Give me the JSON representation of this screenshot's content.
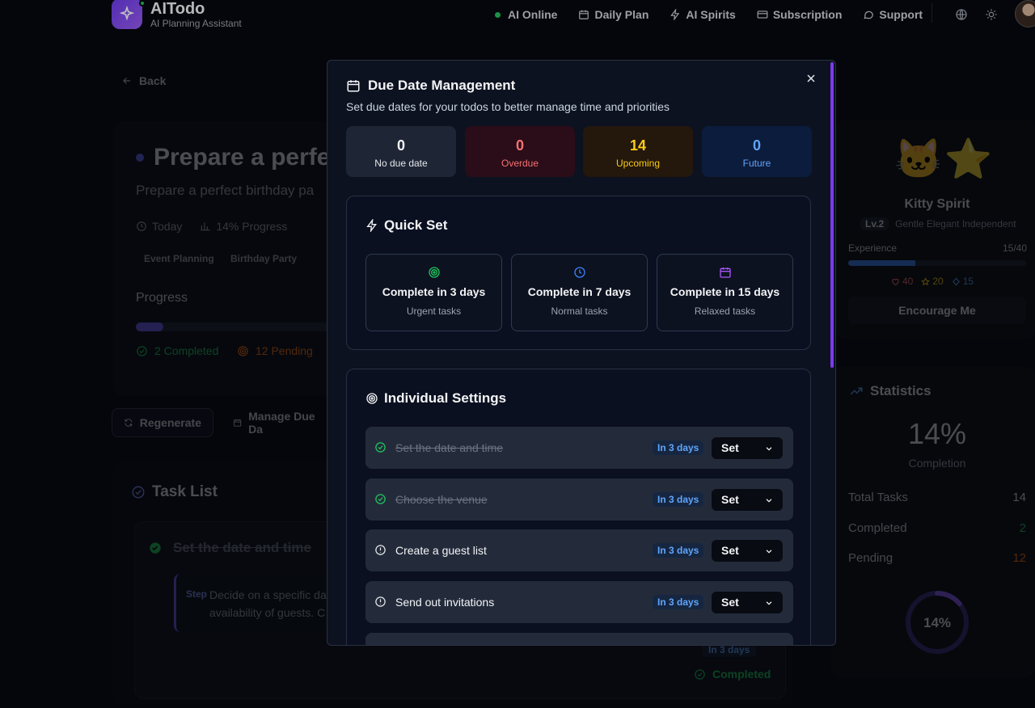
{
  "header": {
    "app_name": "AITodo",
    "app_subtitle": "AI Planning Assistant",
    "nav": [
      "AI Online",
      "Daily Plan",
      "AI Spirits",
      "Subscription",
      "Support"
    ]
  },
  "background": {
    "back_label": "Back",
    "todo_title": "Prepare a perfe",
    "todo_subtitle": "Prepare a perfect birthday pa",
    "meta_date": "Today",
    "meta_progress": "14% Progress",
    "tags": [
      "Event Planning",
      "Birthday Party"
    ],
    "progress_label": "Progress",
    "progress_fraction": 0.14,
    "completed_text": "2 Completed",
    "pending_text": "12 Pending",
    "regenerate_label": "Regenerate",
    "manage_due_label": "Manage Due Da",
    "task_list_title": "Task List",
    "task_item_title": "Set the date and time",
    "step_label": "Step",
    "step_text": "Decide on a specific da availability of guests. C",
    "task_badge": "In 3 days",
    "task_status": "Completed"
  },
  "spirit": {
    "emoji": "🐱⭐",
    "name": "Kitty Spirit",
    "level": "Lv.2",
    "traits": "Gentle Elegant Independent",
    "experience_label": "Experience",
    "experience_value": "15/40",
    "experience_fraction": 0.375,
    "hearts": "40",
    "stars": "20",
    "diamonds": "15",
    "encourage_label": "Encourage Me"
  },
  "statistics": {
    "title": "Statistics",
    "completion_pct": "14%",
    "completion_label": "Completion",
    "rows": [
      {
        "label": "Total Tasks",
        "value": "14",
        "color": "#e5e7eb"
      },
      {
        "label": "Completed",
        "value": "2",
        "color": "#22c55e"
      },
      {
        "label": "Pending",
        "value": "12",
        "color": "#f97316"
      }
    ],
    "ring_label": "14%",
    "ring_fraction": 0.14
  },
  "modal": {
    "title": "Due Date Management",
    "subtitle": "Set due dates for your todos to better manage time and priorities",
    "counts": [
      {
        "value": "0",
        "label": "No due date",
        "bg": "#1e2636",
        "num_color": "#f3f4f6",
        "lbl_color": "#e5e7eb"
      },
      {
        "value": "0",
        "label": "Overdue",
        "bg": "#2a0d18",
        "num_color": "#f87171",
        "lbl_color": "#f87171"
      },
      {
        "value": "14",
        "label": "Upcoming",
        "bg": "#24170c",
        "num_color": "#facc15",
        "lbl_color": "#facc15"
      },
      {
        "value": "0",
        "label": "Future",
        "bg": "#0c1c3c",
        "num_color": "#60a5fa",
        "lbl_color": "#60a5fa"
      }
    ],
    "quick_set_title": "Quick Set",
    "quick_options": [
      {
        "title": "Complete in 3 days",
        "sub": "Urgent tasks",
        "icon": "target-icon",
        "color": "#22c55e"
      },
      {
        "title": "Complete in 7 days",
        "sub": "Normal tasks",
        "icon": "clock-icon",
        "color": "#3b82f6"
      },
      {
        "title": "Complete in 15 days",
        "sub": "Relaxed tasks",
        "icon": "calendar-icon",
        "color": "#a855f7"
      }
    ],
    "individual_title": "Individual Settings",
    "todos": [
      {
        "name": "Set the date and time",
        "done": true,
        "badge": "In 3 days",
        "select": "Set"
      },
      {
        "name": "Choose the venue",
        "done": true,
        "badge": "In 3 days",
        "select": "Set"
      },
      {
        "name": "Create a guest list",
        "done": false,
        "badge": "In 3 days",
        "select": "Set"
      },
      {
        "name": "Send out invitations",
        "done": false,
        "badge": "In 3 days",
        "select": "Set"
      }
    ]
  }
}
